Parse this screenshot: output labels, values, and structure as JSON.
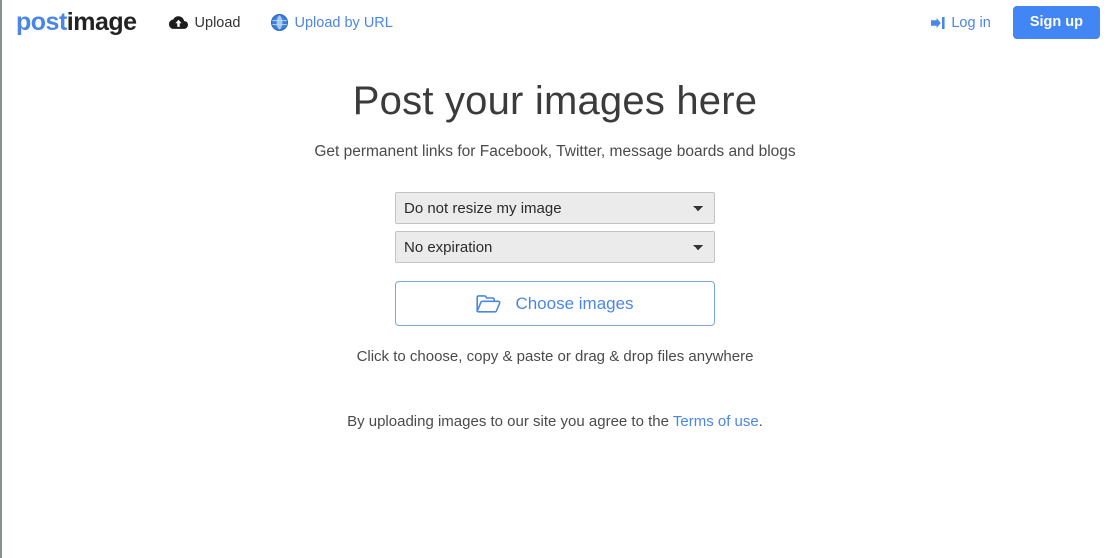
{
  "header": {
    "logo": {
      "part1": "post",
      "part2": "image"
    },
    "nav": [
      {
        "label": "Upload",
        "icon": "cloud-upload-icon"
      },
      {
        "label": "Upload by URL",
        "icon": "globe-icon"
      }
    ],
    "login": {
      "label": "Log in",
      "icon": "sign-in-icon"
    },
    "signup": {
      "label": "Sign up"
    }
  },
  "main": {
    "title": "Post your images here",
    "subtitle": "Get permanent links for Facebook, Twitter, message boards and blogs",
    "resize_select": {
      "value": "Do not resize my image",
      "options": [
        "Do not resize my image"
      ]
    },
    "expiration_select": {
      "value": "No expiration",
      "options": [
        "No expiration"
      ]
    },
    "choose_button": {
      "label": "Choose images",
      "icon": "folder-open-icon"
    },
    "hint": "Click to choose, copy & paste or drag & drop files anywhere",
    "terms": {
      "prefix": "By uploading images to our site you agree to the ",
      "link": "Terms of use",
      "suffix": "."
    }
  },
  "colors": {
    "brand_blue": "#4a86e8",
    "button_blue": "#4285f4",
    "text": "#4a4a4a",
    "select_bg": "#ebebeb"
  }
}
